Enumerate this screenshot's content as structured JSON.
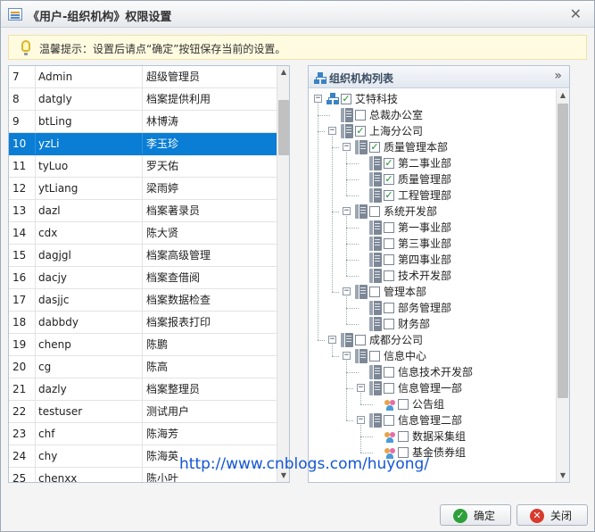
{
  "window": {
    "title": "《用户-组织机构》权限设置",
    "close_glyph": "✕"
  },
  "tip": {
    "text": "温馨提示：设置后请点“确定”按钮保存当前的设置。"
  },
  "users": {
    "selected_index": 3,
    "rows": [
      {
        "no": "7",
        "account": "Admin",
        "name": "超级管理员"
      },
      {
        "no": "8",
        "account": "datgly",
        "name": "档案提供利用"
      },
      {
        "no": "9",
        "account": "btLing",
        "name": "林博涛"
      },
      {
        "no": "10",
        "account": "yzLi",
        "name": "李玉珍"
      },
      {
        "no": "11",
        "account": "tyLuo",
        "name": "罗天佑"
      },
      {
        "no": "12",
        "account": "ytLiang",
        "name": "梁雨婷"
      },
      {
        "no": "13",
        "account": "dazl",
        "name": "档案著录员"
      },
      {
        "no": "14",
        "account": "cdx",
        "name": "陈大贤"
      },
      {
        "no": "15",
        "account": "dagjgl",
        "name": "档案高级管理"
      },
      {
        "no": "16",
        "account": "dacjy",
        "name": "档案查借阅"
      },
      {
        "no": "17",
        "account": "dasjjc",
        "name": "档案数据检查"
      },
      {
        "no": "18",
        "account": "dabbdy",
        "name": "档案报表打印"
      },
      {
        "no": "19",
        "account": "chenp",
        "name": "陈鹏"
      },
      {
        "no": "20",
        "account": "cg",
        "name": "陈高"
      },
      {
        "no": "21",
        "account": "dazly",
        "name": "档案整理员"
      },
      {
        "no": "22",
        "account": "testuser",
        "name": "测试用户"
      },
      {
        "no": "23",
        "account": "chf",
        "name": "陈海芳"
      },
      {
        "no": "24",
        "account": "chy",
        "name": "陈海英"
      },
      {
        "no": "25",
        "account": "chenxx",
        "name": "陈小叶"
      }
    ]
  },
  "org": {
    "title": "组织机构列表",
    "collapse_glyph": "»",
    "nodes": [
      {
        "label": "艾特科技",
        "level": 0,
        "toggle": "−",
        "icon": "org-icon",
        "checked": true
      },
      {
        "label": "总裁办公室",
        "level": 1,
        "toggle": "",
        "icon": "building-icon",
        "checked": false
      },
      {
        "label": "上海分公司",
        "level": 1,
        "toggle": "−",
        "icon": "building-icon",
        "checked": true
      },
      {
        "label": "质量管理本部",
        "level": 2,
        "toggle": "−",
        "icon": "building-icon",
        "checked": true
      },
      {
        "label": "第二事业部",
        "level": 3,
        "toggle": "",
        "icon": "building-icon",
        "checked": true
      },
      {
        "label": "质量管理部",
        "level": 3,
        "toggle": "",
        "icon": "building-icon",
        "checked": true
      },
      {
        "label": "工程管理部",
        "level": 3,
        "toggle": "",
        "icon": "building-icon",
        "checked": true
      },
      {
        "label": "系统开发部",
        "level": 2,
        "toggle": "−",
        "icon": "building-icon",
        "checked": false
      },
      {
        "label": "第一事业部",
        "level": 3,
        "toggle": "",
        "icon": "building-icon",
        "checked": false
      },
      {
        "label": "第三事业部",
        "level": 3,
        "toggle": "",
        "icon": "building-icon",
        "checked": false
      },
      {
        "label": "第四事业部",
        "level": 3,
        "toggle": "",
        "icon": "building-icon",
        "checked": false
      },
      {
        "label": "技术开发部",
        "level": 3,
        "toggle": "",
        "icon": "building-icon",
        "checked": false
      },
      {
        "label": "管理本部",
        "level": 2,
        "toggle": "−",
        "icon": "building-icon",
        "checked": false
      },
      {
        "label": "部务管理部",
        "level": 3,
        "toggle": "",
        "icon": "building-icon",
        "checked": false
      },
      {
        "label": "财务部",
        "level": 3,
        "toggle": "",
        "icon": "building-icon",
        "checked": false
      },
      {
        "label": "成都分公司",
        "level": 1,
        "toggle": "−",
        "icon": "building-icon",
        "checked": false
      },
      {
        "label": "信息中心",
        "level": 2,
        "toggle": "−",
        "icon": "building-icon",
        "checked": false
      },
      {
        "label": "信息技术开发部",
        "level": 3,
        "toggle": "",
        "icon": "building-icon",
        "checked": false
      },
      {
        "label": "信息管理一部",
        "level": 3,
        "toggle": "−",
        "icon": "building-icon",
        "checked": false
      },
      {
        "label": "公告组",
        "level": 4,
        "toggle": "",
        "icon": "group-icon",
        "checked": false
      },
      {
        "label": "信息管理二部",
        "level": 3,
        "toggle": "−",
        "icon": "building-icon",
        "checked": false
      },
      {
        "label": "数据采集组",
        "level": 4,
        "toggle": "",
        "icon": "group-icon",
        "checked": false
      },
      {
        "label": "基金债券组",
        "level": 4,
        "toggle": "",
        "icon": "group-icon",
        "checked": false
      }
    ]
  },
  "buttons": {
    "ok": "确定",
    "close": "关闭"
  },
  "watermark": "http://www.cnblogs.com/huyong/",
  "colors": {
    "selection": "#0a7dd4",
    "check": "#1c8f2a",
    "tip_bg": "#fffbe0"
  }
}
